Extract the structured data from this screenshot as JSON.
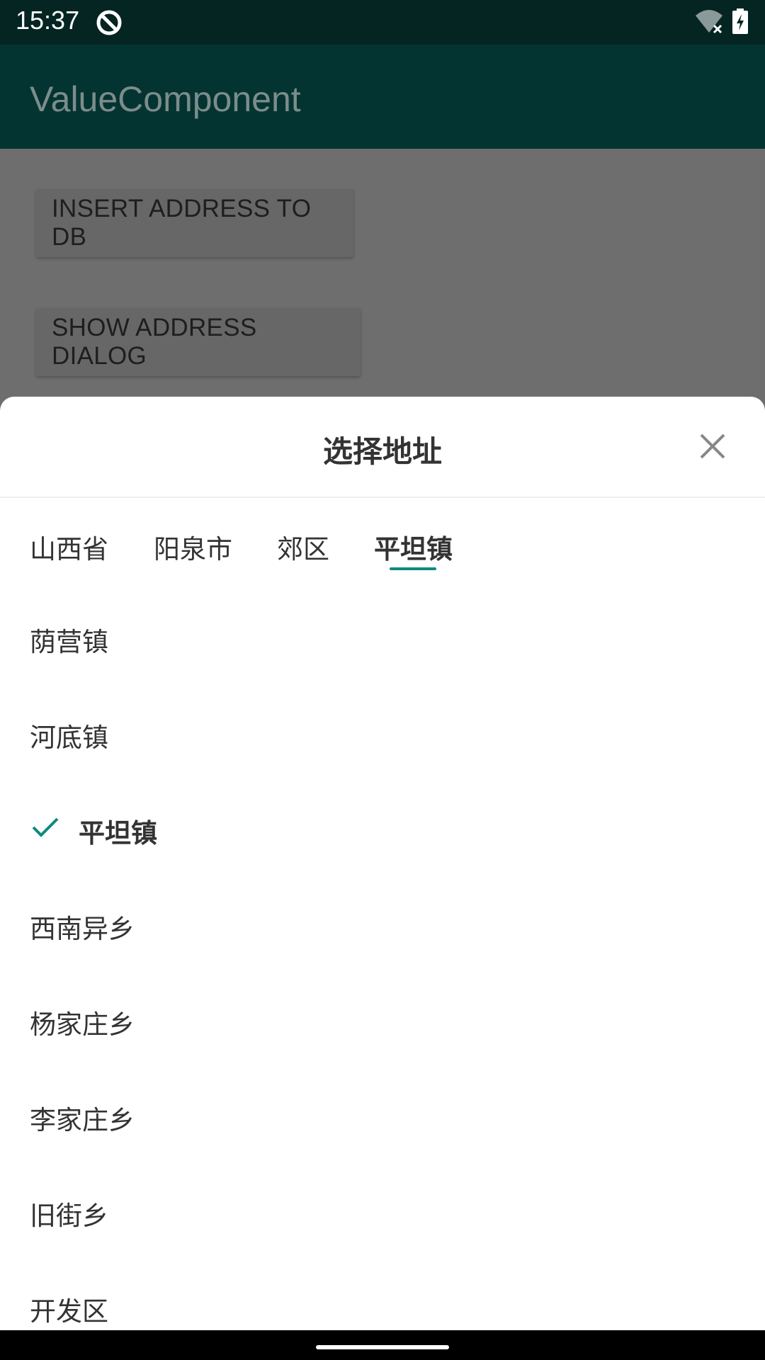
{
  "status_bar": {
    "time": "15:37",
    "icons": [
      "app-notification-icon",
      "wifi-off-icon",
      "battery-charging-icon"
    ]
  },
  "app_bar": {
    "title": "ValueComponent"
  },
  "buttons": {
    "insert_label": "INSERT ADDRESS TO DB",
    "show_label": "SHOW ADDRESS DIALOG"
  },
  "dialog": {
    "title": "选择地址",
    "close_icon": "close-icon",
    "tabs": [
      {
        "label": "山西省",
        "active": false
      },
      {
        "label": "阳泉市",
        "active": false
      },
      {
        "label": "郊区",
        "active": false
      },
      {
        "label": "平坦镇",
        "active": true
      }
    ],
    "items": [
      {
        "label": "荫营镇",
        "selected": false
      },
      {
        "label": "河底镇",
        "selected": false
      },
      {
        "label": "平坦镇",
        "selected": true
      },
      {
        "label": "西南异乡",
        "selected": false
      },
      {
        "label": "杨家庄乡",
        "selected": false
      },
      {
        "label": "李家庄乡",
        "selected": false
      },
      {
        "label": "旧街乡",
        "selected": false
      },
      {
        "label": "开发区",
        "selected": false
      }
    ]
  },
  "colors": {
    "accent": "#0e8a7e",
    "app_bar": "#043431",
    "status_bar": "#042522",
    "scrim": "#6e6e6e"
  }
}
